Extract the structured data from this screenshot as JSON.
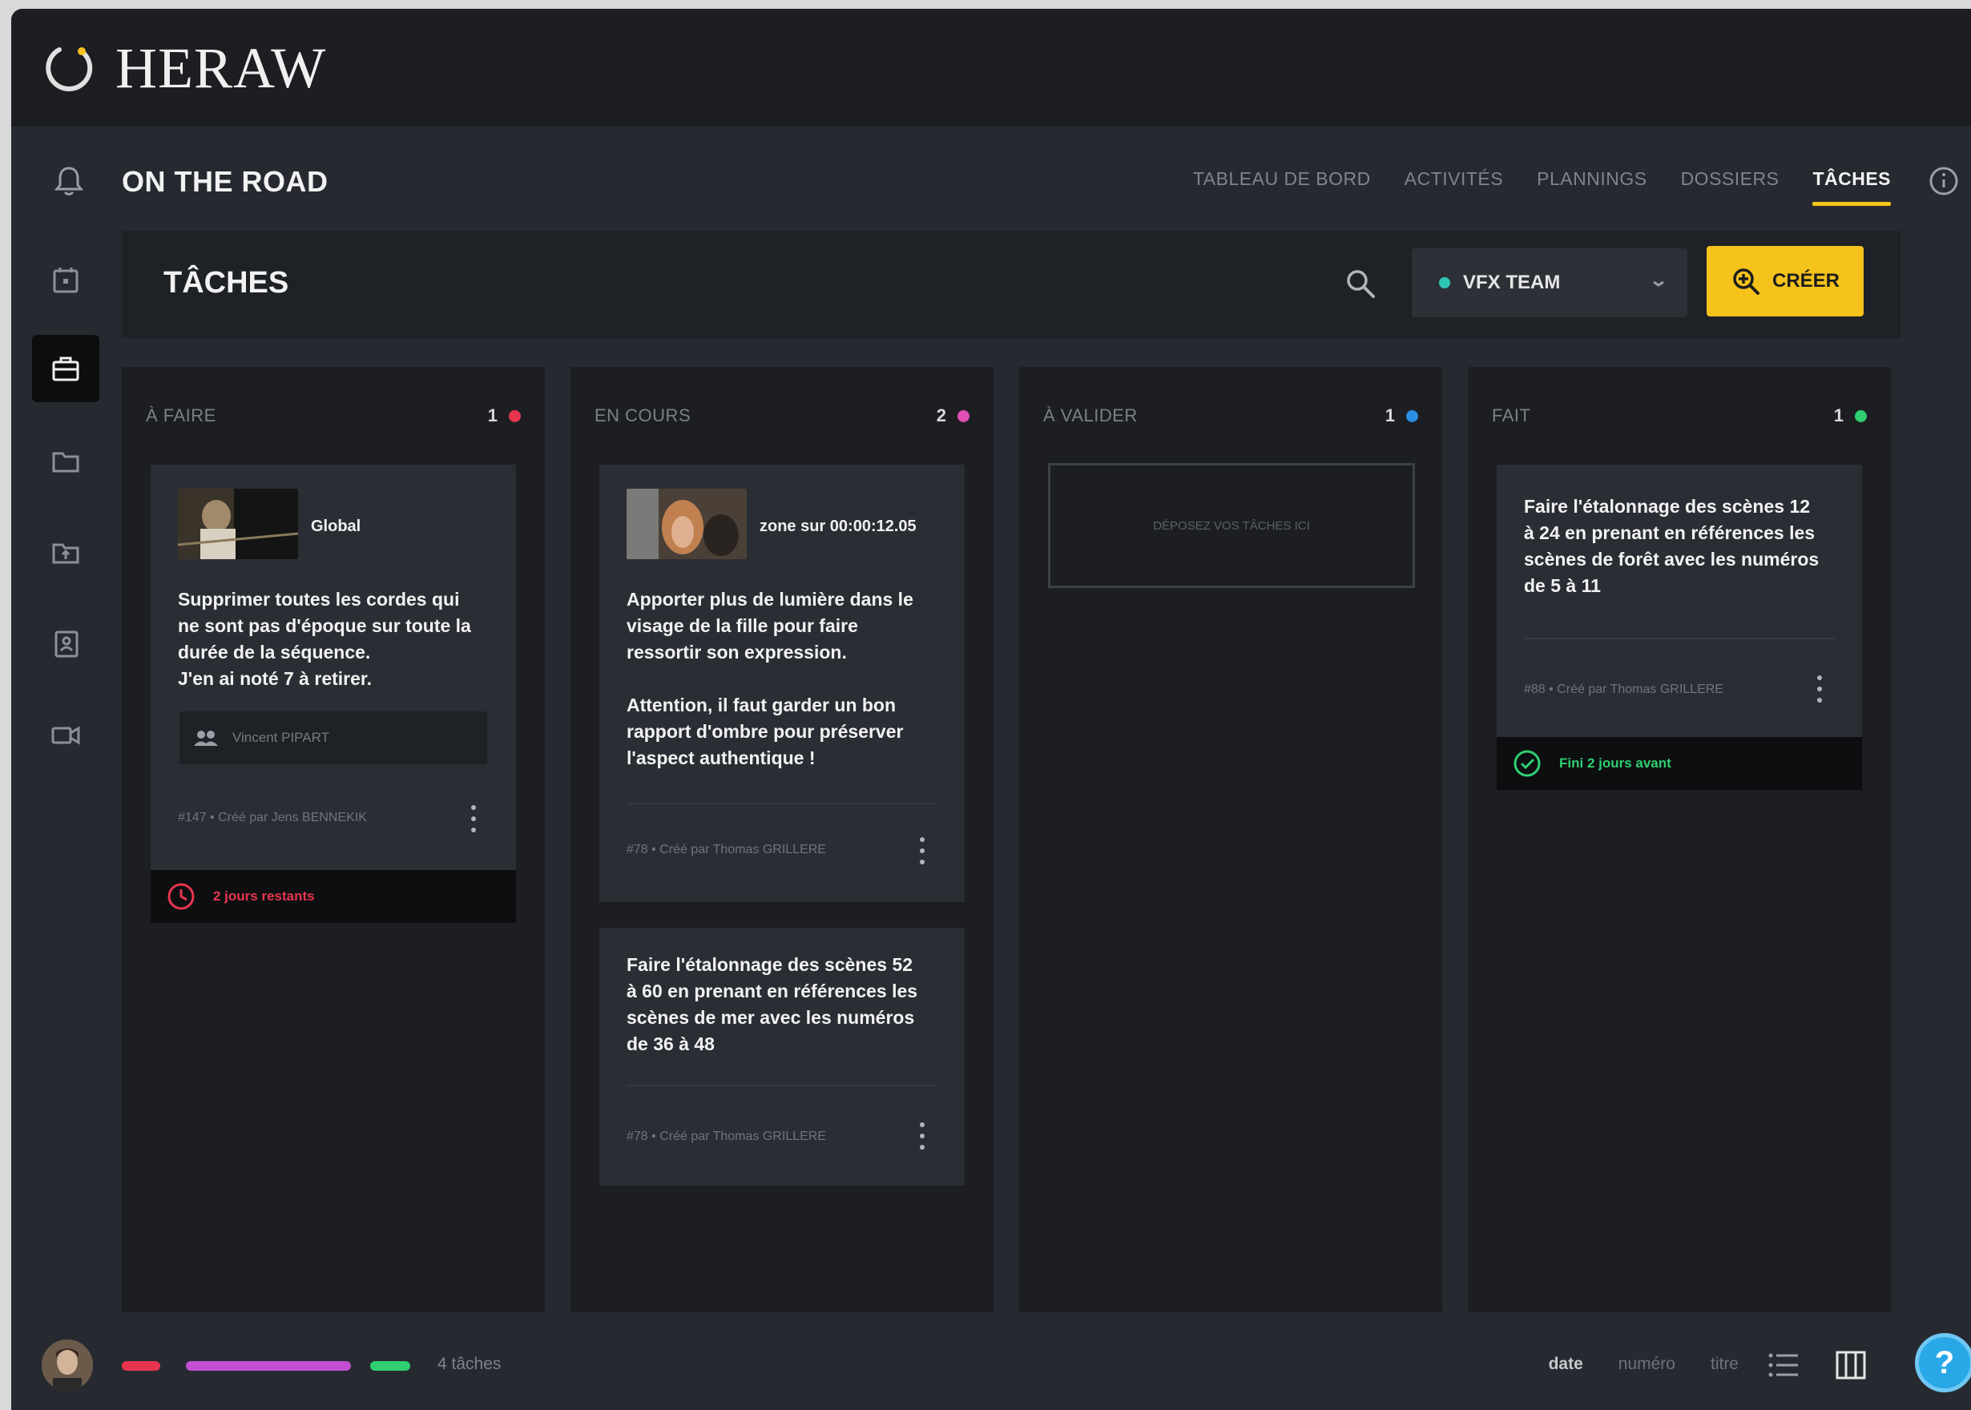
{
  "app": {
    "brand": "HERAW",
    "project_title": "ON THE ROAD"
  },
  "nav": {
    "items": [
      {
        "label": "TABLEAU DE BORD"
      },
      {
        "label": "ACTIVITÉS"
      },
      {
        "label": "PLANNINGS"
      },
      {
        "label": "DOSSIERS"
      },
      {
        "label": "TÂCHES",
        "active": true
      }
    ]
  },
  "sidebar": {
    "icons": [
      "calendar-icon",
      "briefcase-icon",
      "folder-icon",
      "shared-folder-icon",
      "contact-book-icon",
      "video-camera-icon"
    ],
    "active": "briefcase-icon"
  },
  "toolbar": {
    "title": "TÂCHES",
    "team_label": "VFX TEAM",
    "team_color": "#2fc5b6",
    "create_label": "CRÉER",
    "accent": "#f6c21c"
  },
  "columns": [
    {
      "title": "À FAIRE",
      "count": "1",
      "dot_color": "#e8354f",
      "cards": [
        {
          "thumb_label": "Global",
          "text": "Supprimer toutes les cordes qui\nne sont pas d'époque sur toute la\ndurée de la séquence.\nJ'en ai noté 7 à retirer.",
          "assignee": "Vincent PIPART",
          "meta": "#147 • Créé par Jens BENNEKIK",
          "status": "2 jours restants",
          "status_color": "#e8354f"
        }
      ]
    },
    {
      "title": "EN COURS",
      "count": "2",
      "dot_color": "#e04fb3",
      "cards": [
        {
          "thumb_label": "zone sur 00:00:12.05",
          "text": "Apporter plus de lumière dans le\nvisage de la fille pour faire\nressortir son expression.\n\nAttention, il faut garder un bon\nrapport d'ombre pour préserver\nl'aspect authentique !",
          "meta": "#78 • Créé par Thomas GRILLERE"
        },
        {
          "text": "Faire l'étalonnage des scènes 52\nà 60 en prenant en références les\nscènes de mer avec les numéros\nde 36 à 48",
          "meta": "#78 • Créé par Thomas GRILLERE"
        }
      ]
    },
    {
      "title": "À VALIDER",
      "count": "1",
      "dot_color": "#2a8fe0",
      "dropzone": "DÉPOSEZ VOS TÂCHES ICI",
      "cards": []
    },
    {
      "title": "FAIT",
      "count": "1",
      "dot_color": "#2fcf72",
      "cards": [
        {
          "text": "Faire l'étalonnage des scènes 12\nà 24 en prenant en références les\nscènes de forêt avec les numéros\nde 5 à 11",
          "meta": "#88 • Créé par Thomas GRILLERE",
          "status": "Fini 2 jours avant",
          "status_color": "#2fcf72"
        }
      ]
    }
  ],
  "footer": {
    "task_count": "4 tâches",
    "progress": [
      {
        "color": "#e8354f",
        "fraction": 0.25
      },
      {
        "color": "#c24fd0",
        "fraction": 0.5
      },
      {
        "color": "#2fcf72",
        "fraction": 0.25
      }
    ],
    "sort_options": [
      {
        "label": "date",
        "active": true
      },
      {
        "label": "numéro"
      },
      {
        "label": "titre"
      }
    ],
    "help_label": "?"
  }
}
